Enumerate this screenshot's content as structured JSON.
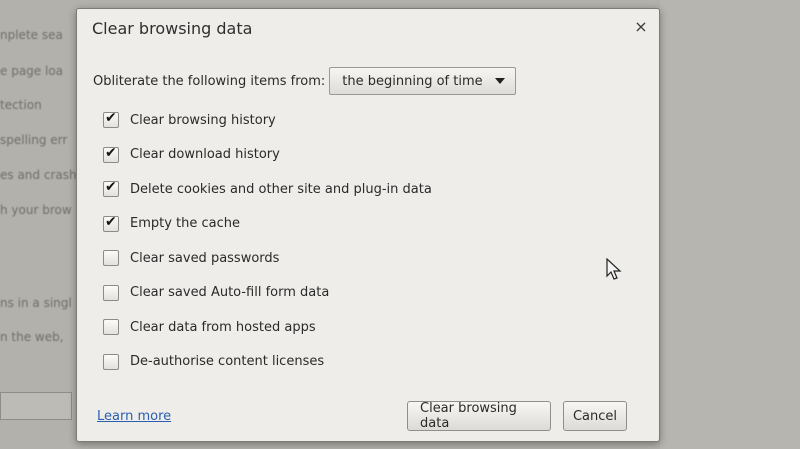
{
  "background": {
    "left_fragments": [
      "nplete sea",
      "e page loa",
      "tection",
      "spelling err",
      "es and crash",
      "h your brow",
      "ns in a singl",
      "n the web,"
    ]
  },
  "dialog": {
    "title": "Clear browsing data",
    "close_glyph": "×",
    "obliterate_label": "Obliterate the following items from:",
    "time_range": {
      "selected": "the beginning of time"
    },
    "options": [
      {
        "label": "Clear browsing history",
        "checked": true
      },
      {
        "label": "Clear download history",
        "checked": true
      },
      {
        "label": "Delete cookies and other site and plug-in data",
        "checked": true
      },
      {
        "label": "Empty the cache",
        "checked": true
      },
      {
        "label": "Clear saved passwords",
        "checked": false
      },
      {
        "label": "Clear saved Auto-fill form data",
        "checked": false
      },
      {
        "label": "Clear data from hosted apps",
        "checked": false
      },
      {
        "label": "De-authorise content licenses",
        "checked": false
      }
    ],
    "learn_more": "Learn more",
    "primary_button": "Clear browsing data",
    "cancel_button": "Cancel"
  }
}
